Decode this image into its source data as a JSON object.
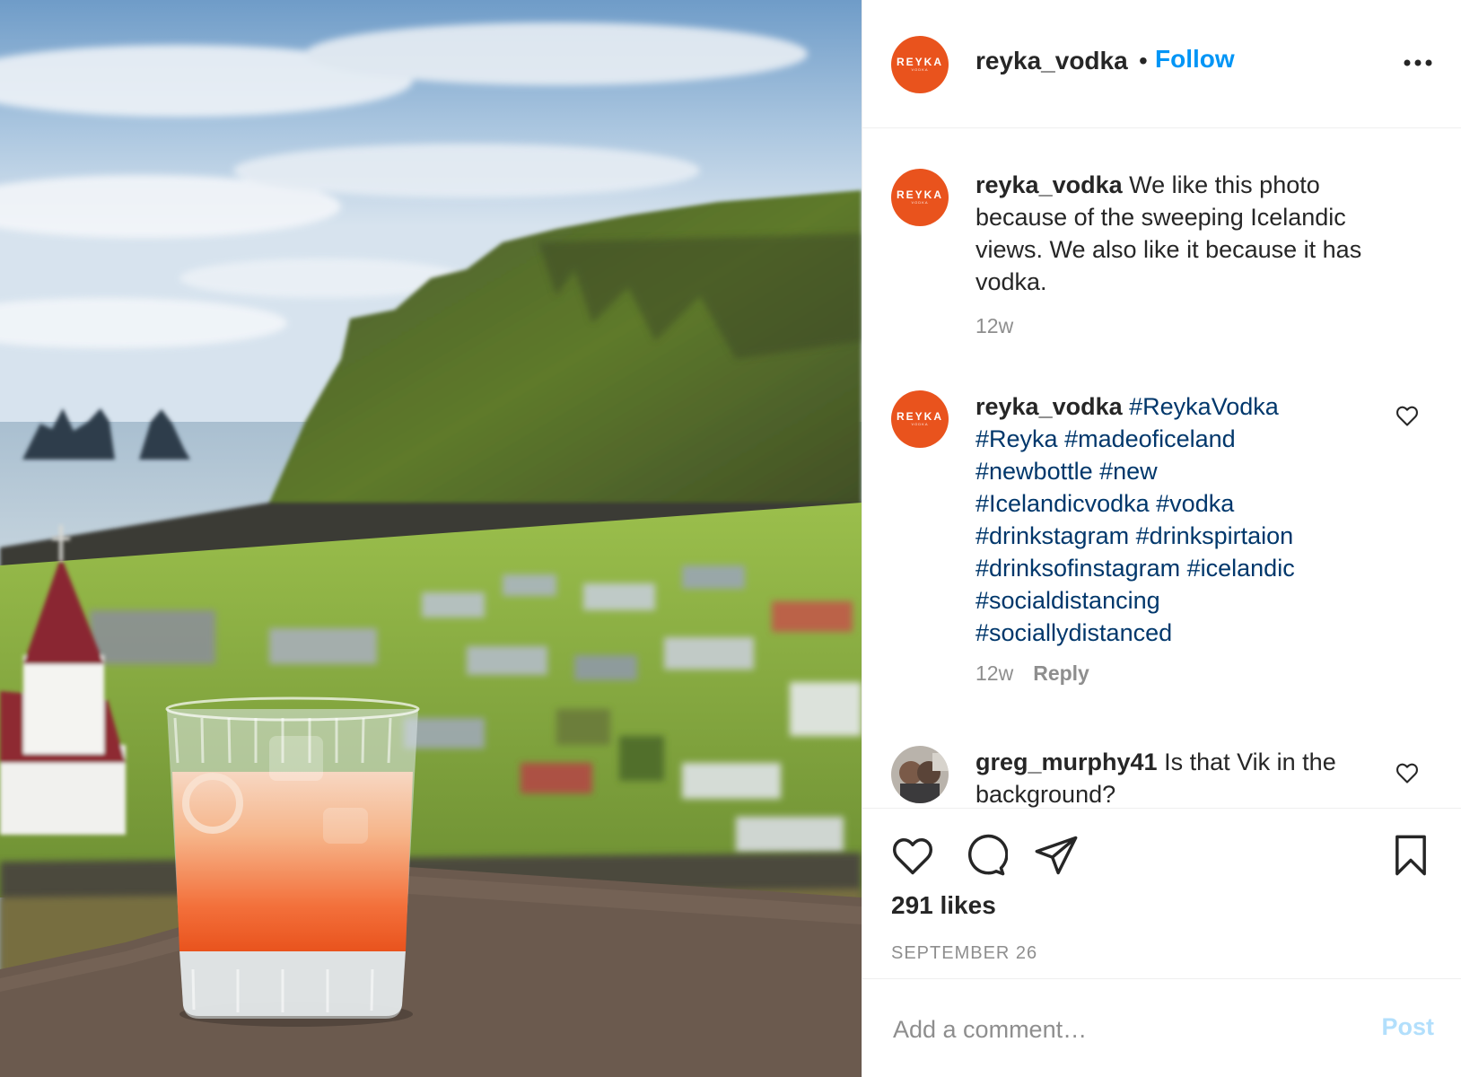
{
  "account": {
    "username": "reyka_vodka",
    "avatar_text": "REYKA",
    "avatar_subtext": "VODKA",
    "brand_color": "#e9531d"
  },
  "header": {
    "separator": "•",
    "follow_label": "Follow",
    "more_icon": "more-horizontal-icon"
  },
  "caption": {
    "username": "reyka_vodka",
    "text": "We like this photo because of the sweeping Icelandic views. We also like it because it has vodka.",
    "time": "12w"
  },
  "comments": [
    {
      "username": "reyka_vodka",
      "hashtags": [
        "#ReykaVodka",
        "#Reyka",
        "#madeoficeland",
        "#newbottle",
        "#new",
        "#Icelandicvodka",
        "#vodka",
        "#drinkstagram",
        "#drinkspirtaion",
        "#drinksofinstagram",
        "#icelandic",
        "#socialdistancing",
        "#sociallydistanced"
      ],
      "time": "12w",
      "reply_label": "Reply"
    },
    {
      "username": "greg_murphy41",
      "text": "Is that Vik in the background?"
    }
  ],
  "actions": {
    "like_icon": "heart-icon",
    "comment_icon": "comment-bubble-icon",
    "share_icon": "paper-plane-icon",
    "save_icon": "bookmark-icon"
  },
  "likes": "291 likes",
  "date": "SEPTEMBER 26",
  "add_comment": {
    "placeholder": "Add a comment…",
    "post_label": "Post"
  },
  "colors": {
    "link_blue": "#0095f6",
    "hashtag": "#00376b",
    "muted": "#8e8e8e"
  }
}
